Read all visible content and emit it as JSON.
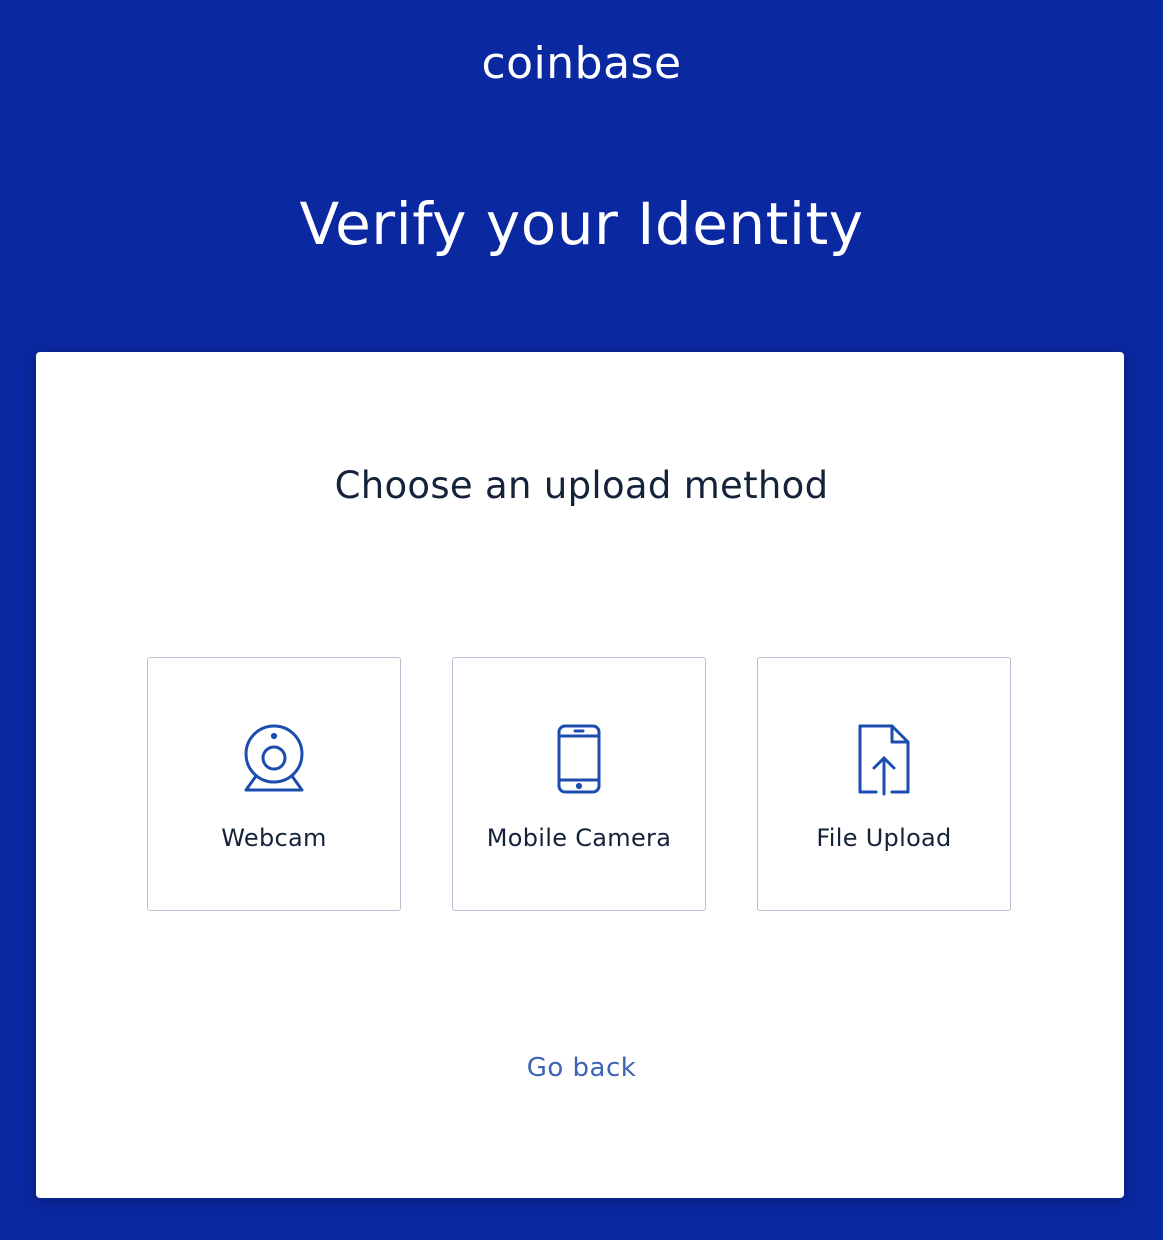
{
  "header": {
    "logo_text": "coinbase",
    "title": "Verify your Identity"
  },
  "card": {
    "heading": "Choose an upload method",
    "options": [
      {
        "label": "Webcam",
        "icon": "webcam-icon"
      },
      {
        "label": "Mobile Camera",
        "icon": "mobile-phone-icon"
      },
      {
        "label": "File Upload",
        "icon": "file-upload-icon"
      }
    ],
    "go_back_label": "Go back"
  },
  "colors": {
    "background": "#0a28a0",
    "card": "#ffffff",
    "icon_stroke": "#1b4dae",
    "text_dark": "#14233a",
    "link": "#3c63b4"
  }
}
